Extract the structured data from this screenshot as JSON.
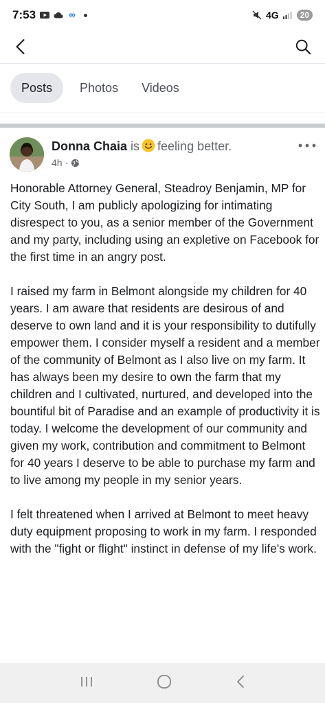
{
  "status_bar": {
    "time": "7:53",
    "network": "4G",
    "battery": "20"
  },
  "top_nav": {
    "back_icon": "back-arrow-icon",
    "search_icon": "search-icon"
  },
  "tabs": [
    {
      "label": "Posts",
      "active": true
    },
    {
      "label": "Photos",
      "active": false
    },
    {
      "label": "Videos",
      "active": false
    }
  ],
  "post": {
    "author": "Donna Chaia",
    "is_text": "is",
    "feeling_text": "feeling better.",
    "time": "4h",
    "privacy_icon": "globe-icon",
    "paragraphs": [
      "Honorable Attorney General, Steadroy Benjamin, MP for City South, I am publicly apologizing for intimating disrespect to you, as a senior member of the Government and my party, including using an expletive on Facebook for the first time in an angry post.",
      "I raised my farm in Belmont alongside my children for 40 years.  I am aware that residents are desirous of and deserve to own land and it is your responsibility to dutifully empower them.  I consider myself a resident and a member of the community of Belmont as I also live on my farm. It has always been my desire to own the farm that my children and I cultivated, nurtured, and developed into the bountiful bit of Paradise and an example of productivity it is today. I welcome the development of our community and given my work, contribution and commitment to Belmont for 40 years I deserve to be able to purchase my farm and to live among my people in my senior years.",
      "I felt threatened when I arrived at Belmont to meet heavy duty equipment proposing to work in my farm. I responded with the \"fight or flight\" instinct in defense of my life's work."
    ]
  },
  "colors": {
    "accent_tab_bg": "#e4e6eb",
    "muted_text": "#65676b",
    "separator": "#c9ccd1"
  }
}
